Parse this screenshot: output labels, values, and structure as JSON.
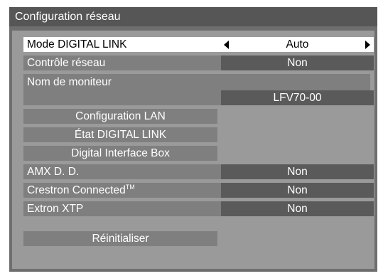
{
  "title": "Configuration réseau",
  "mode_digital_link": {
    "label": "Mode DIGITAL LINK",
    "value": "Auto"
  },
  "controle_reseau": {
    "label": "Contrôle réseau",
    "value": "Non"
  },
  "nom_moniteur": {
    "label": "Nom de moniteur",
    "value": "LFV70-00"
  },
  "buttons": {
    "config_lan": "Configuration LAN",
    "etat_digital_link": "État DIGITAL LINK",
    "digital_interface_box": "Digital Interface Box",
    "reinitialiser": "Réinitialiser"
  },
  "amx": {
    "label": "AMX D. D.",
    "value": "Non"
  },
  "crestron": {
    "label": "Crestron Connected",
    "sup": "TM",
    "value": "Non"
  },
  "extron": {
    "label": "Extron XTP",
    "value": "Non"
  }
}
